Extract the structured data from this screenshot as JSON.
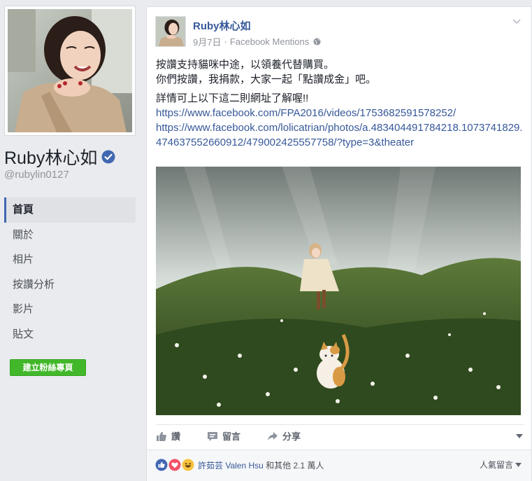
{
  "page": {
    "name": "Ruby林心如",
    "handle": "@rubylin0127",
    "verified": true
  },
  "nav": {
    "items": [
      {
        "label": "首頁",
        "active": true
      },
      {
        "label": "關於",
        "active": false
      },
      {
        "label": "相片",
        "active": false
      },
      {
        "label": "按讚分析",
        "active": false
      },
      {
        "label": "影片",
        "active": false
      },
      {
        "label": "貼文",
        "active": false
      }
    ],
    "create_button": "建立粉絲專頁"
  },
  "post": {
    "author": "Ruby林心如",
    "date": "9月7日",
    "separator": "·",
    "source": "Facebook Mentions",
    "privacy_icon": "globe-icon",
    "text_line_1": "按讚支持貓咪中途，以領養代替購買。",
    "text_line_2": "你們按讚，我捐款，大家一起「點讚成金」吧。",
    "text_line_3": "詳情可上以下這二則網址了解喔!!",
    "link_1": "https://www.facebook.com/FPA2016/videos/1753682591578252/",
    "link_2": "https://www.facebook.com/lolicatrian/photos/a.483404491784218.1073741829.474637552660912/479002425557758/?type=3&theater"
  },
  "actions": {
    "like": "讚",
    "comment": "留言",
    "share": "分享"
  },
  "reactions": {
    "names": "許茹芸 Valen Hsu",
    "summary": "和其他 2.1 萬人",
    "sort_label": "人氣留言",
    "icons": [
      "like-reaction-icon",
      "love-reaction-icon",
      "haha-reaction-icon"
    ]
  },
  "colors": {
    "link": "#365899",
    "accent": "#4267b2",
    "create_button": "#42b72a",
    "page_bg": "#e9ebee"
  }
}
